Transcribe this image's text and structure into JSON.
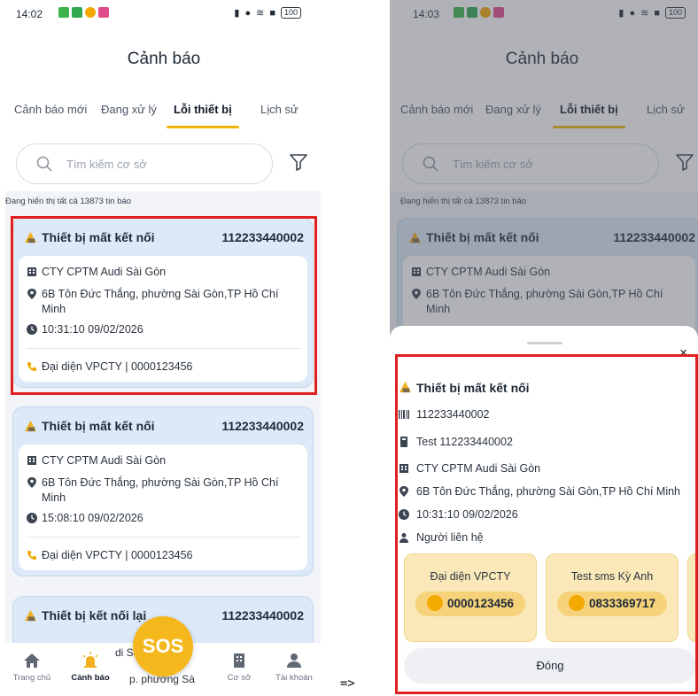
{
  "left": {
    "status": {
      "time": "14:02",
      "battery": "100"
    },
    "title": "Cảnh báo",
    "tabs": [
      "Cảnh báo mới",
      "Đang xử lý",
      "Lỗi thiết bị",
      "Lịch sử"
    ],
    "active_tab": "Lỗi thiết bị",
    "search_placeholder": "Tìm kiếm cơ sở",
    "count_text": "Đang hiển thị tất cả 13873 tin báo",
    "cards": [
      {
        "title": "Thiết bị mất kết nối",
        "code": "112233440002",
        "company": "CTY CPTM Audi Sài Gòn",
        "address": "6B Tôn Đức Thắng, phường Sài Gòn,TP Hồ Chí Minh",
        "time": "10:31:10 09/02/2026",
        "contact": "Đại diện VPCTY | 0000123456"
      },
      {
        "title": "Thiết bị mất kết nối",
        "code": "112233440002",
        "company": "CTY CPTM Audi Sài Gòn",
        "address": "6B Tôn Đức Thắng, phường Sài Gòn,TP Hồ Chí Minh",
        "time": "15:08:10 09/02/2026",
        "contact": "Đại diện VPCTY | 0000123456"
      },
      {
        "title": "Thiết bị kết nối lại",
        "code": "112233440002"
      }
    ],
    "nav": {
      "home": "Trang chủ",
      "alert": "Cảnh báo",
      "sos": "SOS",
      "facility": "Cơ sở",
      "account": "Tài khoản"
    },
    "behind_sos": [
      "di Sà",
      "p. phường Sà"
    ]
  },
  "arrow": "=>",
  "right": {
    "status": {
      "time": "14:03",
      "battery": "100"
    },
    "title": "Cảnh báo",
    "tabs": [
      "Cảnh báo mới",
      "Đang xử lý",
      "Lỗi thiết bị",
      "Lịch sử"
    ],
    "search_placeholder": "Tìm kiếm cơ sở",
    "count_text": "Đang hiển thị tất cả 13873 tin báo",
    "bg_card": {
      "title": "Thiết bị mất kết nối",
      "code": "112233440002",
      "company": "CTY CPTM Audi Sài Gòn",
      "address_line1": "6B Tôn Đức Thắng, phường Sài Gòn,TP Hồ Chí",
      "address_line2": "Minh"
    },
    "sheet": {
      "close": "×",
      "title": "Thiết bị mất kết nối",
      "code": "112233440002",
      "device": "Test 112233440002",
      "company": "CTY CPTM Audi Sài Gòn",
      "address": "6B Tôn Đức Thắng, phường Sài Gòn,TP Hồ Chí Minh",
      "time": "10:31:10 09/02/2026",
      "contact_label": "Người liên hệ",
      "contacts": [
        {
          "name": "Đại diện VPCTY",
          "phone": "0000123456"
        },
        {
          "name": "Test sms Kỳ Anh",
          "phone": "0833369717"
        }
      ],
      "close_button": "Đóng"
    }
  },
  "colors": {
    "accent": "#f5b81c",
    "card_bg": "#dbe9f8",
    "highlight": "#e02020",
    "contact_bg": "#fbe8b8"
  }
}
